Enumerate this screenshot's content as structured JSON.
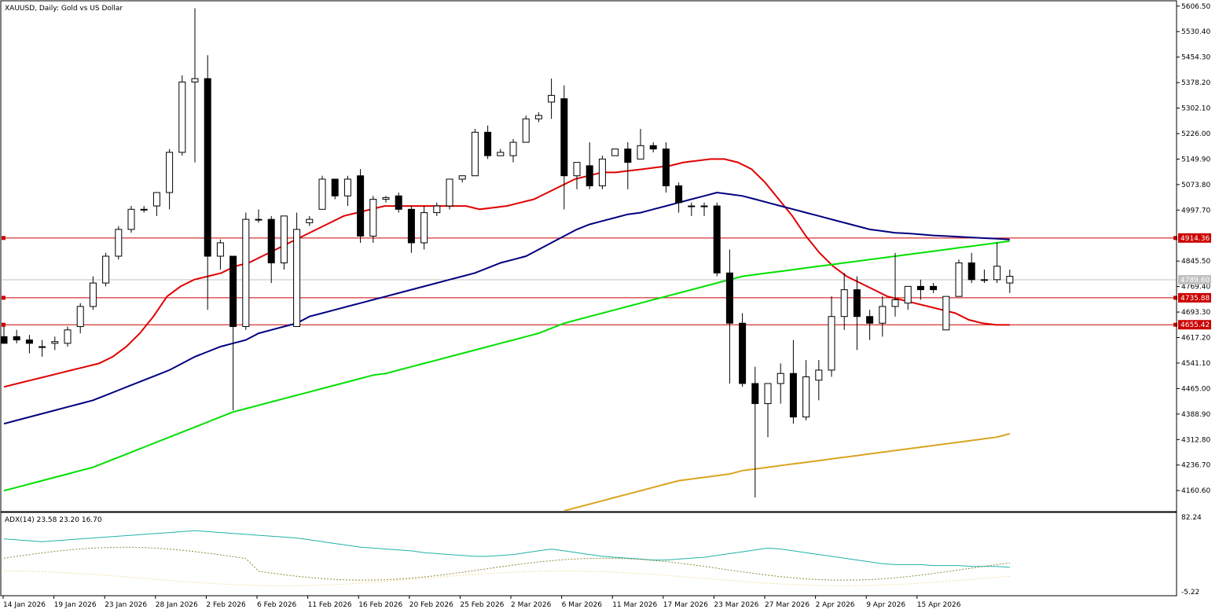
{
  "chart_data": {
    "type": "candlestick",
    "title": "XAUUSD, Daily:  Gold vs US Dollar",
    "symbol": "XAUUSD",
    "timeframe": "Daily",
    "description": "Gold vs US Dollar",
    "colors": {
      "background": "#ffffff",
      "bull_body": "#ffffff",
      "bear_body": "#000000",
      "candle_outline": "#000000",
      "ma_red": "#e00000",
      "ma_navy": "#000080",
      "ma_green": "#00e000",
      "ma_gold": "#daa520",
      "level_line": "#cc0000",
      "current_price_line": "#c0c0c0",
      "adx_main": "#20b2aa",
      "adx_plus": "#8b8b3a",
      "adx_minus": "#f0e0a0"
    },
    "price_axis": {
      "ylim": [
        4100,
        5620
      ],
      "ticks": [
        "5606.50",
        "5530.40",
        "5454.30",
        "5378.20",
        "5302.10",
        "5226.00",
        "5149.90",
        "5073.80",
        "4997.70",
        "4845.50",
        "4769.40",
        "4693.30",
        "4617.20",
        "4541.10",
        "4465.00",
        "4388.90",
        "4312.80",
        "4236.70",
        "4160.60"
      ]
    },
    "date_axis": {
      "labels": [
        "14 Jan 2026",
        "19 Jan 2026",
        "23 Jan 2026",
        "28 Jan 2026",
        "2 Feb 2026",
        "6 Feb 2026",
        "11 Feb 2026",
        "16 Feb 2026",
        "20 Feb 2026",
        "25 Feb 2026",
        "2 Mar 2026",
        "6 Mar 2026",
        "11 Mar 2026",
        "17 Mar 2026",
        "23 Mar 2026",
        "27 Mar 2026",
        "2 Apr 2026",
        "9 Apr 2026",
        "15 Apr 2026"
      ]
    },
    "price_levels": [
      {
        "label": "4914.36",
        "value": 4914.36
      },
      {
        "label": "4735.88",
        "value": 4735.88
      },
      {
        "label": "4655.42",
        "value": 4655.42
      }
    ],
    "current_price": {
      "label": "4789.60",
      "value": 4789.6
    },
    "candles": [
      [
        4620,
        4650,
        4600,
        4600
      ],
      [
        4620,
        4640,
        4600,
        4610
      ],
      [
        4610,
        4625,
        4570,
        4600
      ],
      [
        4590,
        4610,
        4560,
        4590
      ],
      [
        4600,
        4620,
        4580,
        4605
      ],
      [
        4600,
        4650,
        4590,
        4640
      ],
      [
        4650,
        4720,
        4630,
        4710
      ],
      [
        4710,
        4800,
        4700,
        4780
      ],
      [
        4780,
        4870,
        4770,
        4860
      ],
      [
        4860,
        4950,
        4850,
        4940
      ],
      [
        4940,
        5010,
        4930,
        5000
      ],
      [
        5000,
        5010,
        4990,
        5000
      ],
      [
        5010,
        5050,
        4980,
        5050
      ],
      [
        5050,
        5180,
        5000,
        5170
      ],
      [
        5170,
        5400,
        5160,
        5380
      ],
      [
        5380,
        5600,
        5140,
        5390
      ],
      [
        5390,
        5460,
        4700,
        4860
      ],
      [
        4860,
        4910,
        4820,
        4900
      ],
      [
        4860,
        4860,
        4400,
        4650
      ],
      [
        4650,
        4990,
        4640,
        4970
      ],
      [
        4970,
        5000,
        4960,
        4970
      ],
      [
        4970,
        4980,
        4780,
        4840
      ],
      [
        4840,
        4980,
        4820,
        4980
      ],
      [
        4650,
        4990,
        4650,
        4940
      ],
      [
        4960,
        4980,
        4950,
        4970
      ],
      [
        5000,
        5100,
        5000,
        5090
      ],
      [
        5090,
        5090,
        5030,
        5040
      ],
      [
        5040,
        5100,
        5010,
        5090
      ],
      [
        5100,
        5120,
        4900,
        4920
      ],
      [
        4920,
        5040,
        4900,
        5030
      ],
      [
        5030,
        5040,
        5020,
        5035
      ],
      [
        5040,
        5050,
        4990,
        5000
      ],
      [
        5000,
        5010,
        4870,
        4900
      ],
      [
        4900,
        5010,
        4880,
        4990
      ],
      [
        4990,
        5020,
        4980,
        5010
      ],
      [
        5010,
        5090,
        5000,
        5090
      ],
      [
        5090,
        5100,
        5080,
        5100
      ],
      [
        5100,
        5240,
        5100,
        5230
      ],
      [
        5230,
        5250,
        5150,
        5160
      ],
      [
        5160,
        5180,
        5160,
        5170
      ],
      [
        5160,
        5210,
        5140,
        5200
      ],
      [
        5200,
        5280,
        5200,
        5270
      ],
      [
        5270,
        5290,
        5260,
        5280
      ],
      [
        5320,
        5390,
        5270,
        5340
      ],
      [
        5330,
        5370,
        5000,
        5100
      ],
      [
        5100,
        5140,
        5060,
        5140
      ],
      [
        5130,
        5200,
        5060,
        5070
      ],
      [
        5070,
        5160,
        5060,
        5150
      ],
      [
        5160,
        5180,
        5160,
        5180
      ],
      [
        5180,
        5200,
        5060,
        5140
      ],
      [
        5150,
        5240,
        5150,
        5190
      ],
      [
        5190,
        5200,
        5170,
        5180
      ],
      [
        5180,
        5200,
        5050,
        5070
      ],
      [
        5070,
        5080,
        4990,
        5020
      ],
      [
        5010,
        5020,
        4980,
        5010
      ],
      [
        5010,
        5020,
        4980,
        5010
      ],
      [
        5010,
        5020,
        4800,
        4810
      ],
      [
        4810,
        4880,
        4480,
        4660
      ],
      [
        4660,
        4690,
        4470,
        4480
      ],
      [
        4480,
        4530,
        4140,
        4420
      ],
      [
        4420,
        4470,
        4320,
        4480
      ],
      [
        4480,
        4540,
        4420,
        4510
      ],
      [
        4510,
        4610,
        4360,
        4380
      ],
      [
        4380,
        4550,
        4370,
        4500
      ],
      [
        4490,
        4550,
        4430,
        4520
      ],
      [
        4520,
        4740,
        4500,
        4680
      ],
      [
        4680,
        4810,
        4640,
        4760
      ],
      [
        4760,
        4800,
        4580,
        4680
      ],
      [
        4680,
        4700,
        4610,
        4660
      ],
      [
        4660,
        4740,
        4620,
        4710
      ],
      [
        4710,
        4870,
        4680,
        4730
      ],
      [
        4720,
        4770,
        4700,
        4770
      ],
      [
        4770,
        4790,
        4730,
        4760
      ],
      [
        4770,
        4780,
        4750,
        4760
      ],
      [
        4640,
        4740,
        4640,
        4740
      ],
      [
        4740,
        4850,
        4740,
        4840
      ],
      [
        4840,
        4870,
        4780,
        4790
      ],
      [
        4790,
        4820,
        4780,
        4790
      ],
      [
        4790,
        4900,
        4780,
        4830
      ],
      [
        4780,
        4820,
        4750,
        4800
      ]
    ],
    "moving_averages": [
      {
        "color": "#e00000",
        "values": [
          4470,
          4480,
          4490,
          4500,
          4510,
          4520,
          4530,
          4540,
          4560,
          4590,
          4630,
          4680,
          4740,
          4770,
          4790,
          4800,
          4810,
          4830,
          4840,
          4860,
          4880,
          4900,
          4920,
          4940,
          4960,
          4980,
          4990,
          5000,
          5010,
          5010,
          5010,
          5010,
          5010,
          5010,
          5010,
          5000,
          5005,
          5010,
          5020,
          5030,
          5050,
          5070,
          5090,
          5100,
          5110,
          5110,
          5115,
          5120,
          5125,
          5130,
          5140,
          5145,
          5150,
          5150,
          5140,
          5120,
          5080,
          5030,
          4980,
          4920,
          4870,
          4830,
          4800,
          4780,
          4760,
          4740,
          4730,
          4720,
          4710,
          4700,
          4690,
          4670,
          4660,
          4655,
          4655
        ]
      },
      {
        "color": "#000080",
        "values": [
          4360,
          4370,
          4380,
          4390,
          4400,
          4410,
          4420,
          4430,
          4445,
          4460,
          4475,
          4490,
          4505,
          4520,
          4540,
          4560,
          4575,
          4590,
          4600,
          4610,
          4630,
          4640,
          4650,
          4660,
          4680,
          4690,
          4700,
          4710,
          4720,
          4730,
          4740,
          4750,
          4760,
          4770,
          4780,
          4790,
          4800,
          4810,
          4825,
          4840,
          4850,
          4860,
          4880,
          4900,
          4920,
          4940,
          4955,
          4965,
          4975,
          4985,
          4990,
          5000,
          5010,
          5020,
          5030,
          5040,
          5050,
          5045,
          5040,
          5030,
          5020,
          5010,
          5000,
          4990,
          4980,
          4970,
          4960,
          4950,
          4940,
          4935,
          4930,
          4928,
          4925,
          4922,
          4920,
          4918,
          4916,
          4914,
          4912,
          4910
        ]
      },
      {
        "color": "#00e000",
        "values": [
          4160,
          4170,
          4180,
          4190,
          4200,
          4210,
          4220,
          4230,
          4245,
          4260,
          4275,
          4290,
          4305,
          4320,
          4335,
          4350,
          4365,
          4380,
          4395,
          4405,
          4415,
          4425,
          4435,
          4445,
          4455,
          4465,
          4475,
          4485,
          4495,
          4505,
          4510,
          4520,
          4530,
          4540,
          4550,
          4560,
          4570,
          4580,
          4590,
          4600,
          4610,
          4620,
          4630,
          4645,
          4660,
          4670,
          4680,
          4690,
          4700,
          4710,
          4720,
          4730,
          4740,
          4750,
          4760,
          4770,
          4780,
          4790,
          4800,
          4805,
          4810,
          4815,
          4820,
          4825,
          4830,
          4835,
          4840,
          4845,
          4850,
          4855,
          4860,
          4865,
          4870,
          4875,
          4880,
          4885,
          4890,
          4895,
          4900,
          4905
        ]
      },
      {
        "color": "#daa520",
        "values": [
          null,
          null,
          null,
          null,
          null,
          null,
          null,
          null,
          null,
          null,
          null,
          null,
          null,
          null,
          null,
          null,
          null,
          null,
          null,
          null,
          null,
          null,
          null,
          null,
          null,
          null,
          null,
          null,
          null,
          null,
          null,
          null,
          null,
          null,
          null,
          null,
          null,
          null,
          null,
          null,
          null,
          null,
          null,
          null,
          4100,
          4110,
          4120,
          4130,
          4140,
          4150,
          4160,
          4170,
          4180,
          4190,
          4195,
          4200,
          4205,
          4210,
          4220,
          4225,
          4230,
          4235,
          4240,
          4245,
          4250,
          4255,
          4260,
          4265,
          4270,
          4275,
          4280,
          4285,
          4290,
          4295,
          4300,
          4305,
          4310,
          4315,
          4320,
          4330
        ]
      }
    ],
    "indicator": {
      "label": "ADX(14) 23.58 23.20 16.70",
      "ylim": [
        -5.22,
        82.24
      ],
      "ticks": [
        "82.24",
        "-5.22"
      ],
      "adx": [
        55,
        54,
        53,
        52,
        53,
        54,
        55,
        56,
        57,
        58,
        59,
        60,
        61,
        62,
        63,
        64,
        63,
        62,
        61,
        60,
        59,
        58,
        57,
        56,
        54,
        52,
        50,
        48,
        46,
        45,
        44,
        43,
        42,
        40,
        39,
        38,
        37,
        36,
        36,
        37,
        38,
        40,
        42,
        44,
        42,
        40,
        38,
        36,
        35,
        34,
        33,
        32,
        32,
        33,
        34,
        35,
        37,
        39,
        41,
        43,
        45,
        44,
        42,
        40,
        38,
        36,
        34,
        32,
        30,
        28,
        27,
        27,
        27,
        26,
        26,
        26,
        25,
        25,
        25,
        24
      ]
    }
  }
}
